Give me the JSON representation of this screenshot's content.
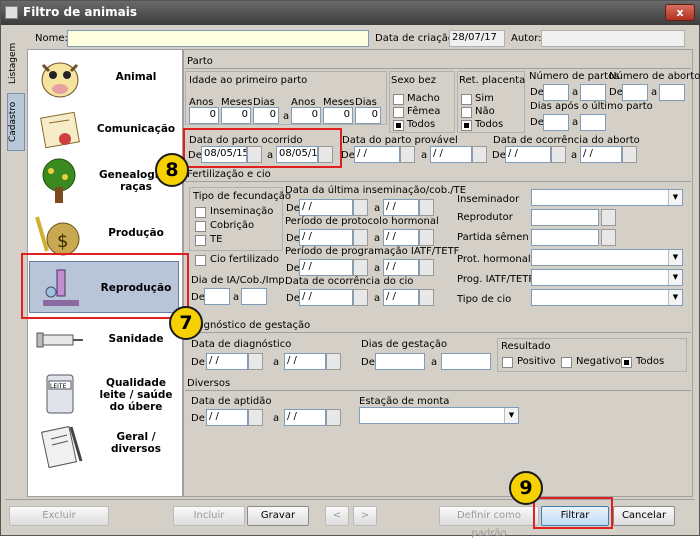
{
  "window": {
    "title": "Filtro de animais",
    "close": "x"
  },
  "header": {
    "name_label": "Nome:",
    "name_value": "",
    "date_label": "Data de criação:",
    "date_value": "28/07/17",
    "author_label": "Autor:",
    "author_value": ""
  },
  "side_tabs": [
    "Listagem",
    "Cadastro"
  ],
  "nav": [
    {
      "label": "Animal"
    },
    {
      "label": "Comunicação"
    },
    {
      "label": "Genealogia / raças"
    },
    {
      "label": "Produção"
    },
    {
      "label": "Reprodução"
    },
    {
      "label": "Sanidade"
    },
    {
      "label": "Qualidade leite / saúde do úbere"
    },
    {
      "label": "Geral / diversos"
    }
  ],
  "parto": {
    "title": "Parto",
    "idade_label": "Idade ao primeiro parto",
    "anos1": "Anos",
    "meses1": "Meses",
    "dias1": "Dias",
    "a": "a",
    "anos2": "Anos",
    "meses2": "Meses",
    "dias2": "Dias",
    "v_anos1": "0",
    "v_meses1": "0",
    "v_dias1": "0",
    "v_anos2": "0",
    "v_meses2": "0",
    "v_dias2": "0",
    "sexo_label": "Sexo bez",
    "sexo_opts": [
      "Macho",
      "Fêmea",
      "Todos"
    ],
    "ret_label": "Ret. placenta",
    "ret_opts": [
      "Sim",
      "Não",
      "Todos"
    ],
    "num_partos": "Número de partos",
    "num_abortos": "Número de abortos",
    "de": "De",
    "dias_ultimo": "Dias após o último parto",
    "data_parto": "Data do parto ocorrido",
    "data_parto_de": "08/05/15",
    "data_parto_a": "08/05/15",
    "data_provavel": "Data do parto provável",
    "data_aborto": "Data de ocorrência do aborto",
    "empty_date": "/ /"
  },
  "fert": {
    "title": "Fertilização e cio",
    "tipo": "Tipo de fecundação",
    "tipo_opts": [
      "Inseminação",
      "Cobrição",
      "TE"
    ],
    "cio": "Cio fertilizado",
    "dia_ia": "Dia de IA/Cob./Imp.",
    "data_insem": "Data da última inseminação/cob./TE",
    "periodo_hormonal": "Período de protocolo hormonal",
    "periodo_iatf": "Período de programação IATF/TETF",
    "data_cio": "Data de ocorrência do cio",
    "inseminador": "Inseminador",
    "reprodutor": "Reprodutor",
    "partida": "Partida sêmen",
    "prot_hormonal": "Prot. hormonal",
    "prog_iatf": "Prog. IATF/TETF",
    "tipo_cio": "Tipo de cio"
  },
  "diag": {
    "title": "Diagnóstico de gestação",
    "data_diag": "Data de diagnóstico",
    "dias_gest": "Dias de gestação",
    "resultado": "Resultado",
    "res_opts": [
      "Positivo",
      "Negativo",
      "Todos"
    ]
  },
  "diversos": {
    "title": "Diversos",
    "data_aptidao": "Data de aptidão",
    "estacao": "Estação de monta"
  },
  "buttons": {
    "excluir": "Excluir",
    "incluir": "Incluir",
    "gravar": "Gravar",
    "prev": "<",
    "next": ">",
    "definir": "Definir como padrão",
    "filtrar": "Filtrar",
    "cancelar": "Cancelar"
  },
  "badges": {
    "b7": "7",
    "b8": "8",
    "b9": "9"
  }
}
